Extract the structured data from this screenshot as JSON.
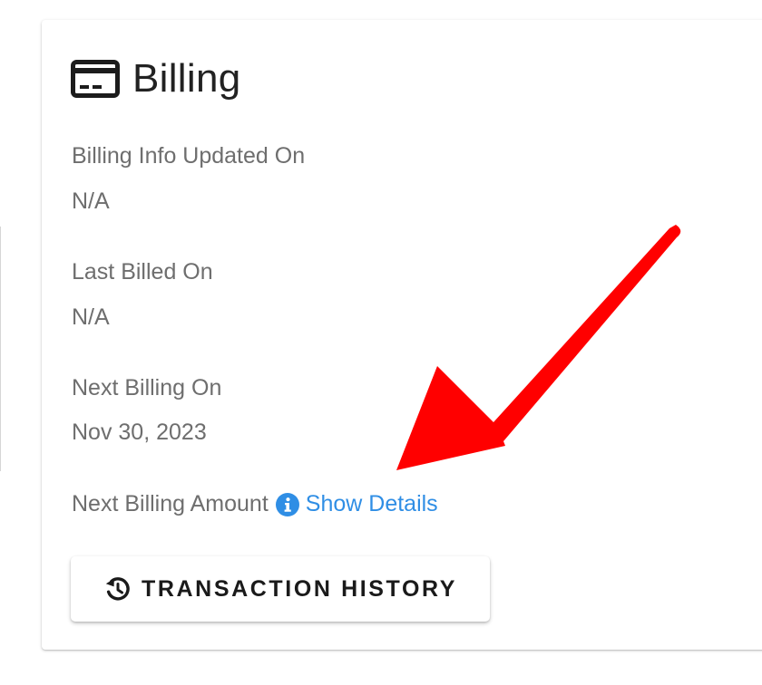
{
  "card": {
    "icon": "credit-card-icon",
    "title": "Billing"
  },
  "fields": [
    {
      "label": "Billing Info Updated On",
      "value": "N/A"
    },
    {
      "label": "Last Billed On",
      "value": "N/A"
    },
    {
      "label": "Next Billing On",
      "value": "Nov 30, 2023"
    }
  ],
  "next_amount": {
    "label": "Next Billing Amount",
    "info_icon": "info-circle-icon",
    "link_label": "Show Details"
  },
  "button": {
    "icon": "history-icon",
    "label": "TRANSACTION HISTORY"
  },
  "colors": {
    "annotation_arrow": "#ff0000",
    "link": "#2f8ee5",
    "text_secondary": "#6e6e6e"
  }
}
